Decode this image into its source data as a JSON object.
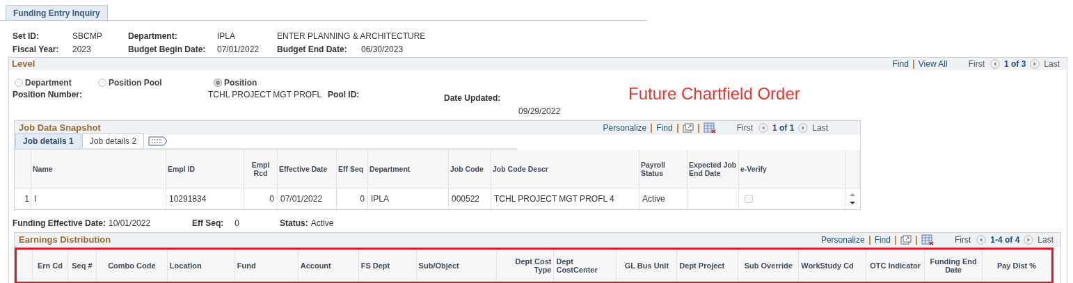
{
  "tabs": [
    {
      "label": "Funding Entry Inquiry",
      "selected": true
    }
  ],
  "header": {
    "rows": [
      {
        "fields": [
          {
            "label": "Set ID:",
            "value": "SBCMP"
          },
          {
            "label": "Department:",
            "value": "IPLA",
            "extra": "ENTER PLANNING & ARCHITECTURE"
          }
        ]
      },
      {
        "fields": [
          {
            "label": "Fiscal Year:",
            "value": "2023"
          },
          {
            "label": "Budget Begin Date:",
            "value": "07/01/2022"
          },
          {
            "label": "Budget End Date:",
            "value": "06/30/2023"
          }
        ]
      }
    ]
  },
  "level": {
    "title": "Level",
    "nav": {
      "find": "Find",
      "view_all": "View All",
      "first": "First",
      "count": "1 of 3",
      "last": "Last"
    },
    "radios": [
      {
        "label": "Department",
        "selected": false
      },
      {
        "label": "Position Pool",
        "selected": false
      },
      {
        "label": "Position",
        "selected": true
      }
    ],
    "position_number_label": "Position Number:",
    "position_descr": "TCHL PROJECT MGT PROFL",
    "pool_id_label": "Pool ID:",
    "date_updated_label": "Date Updated:",
    "date_updated": "09/29/2022",
    "annotation": "Future Chartfield Order"
  },
  "job_snapshot": {
    "title": "Job Data Snapshot",
    "toolbar": {
      "personalize": "Personalize",
      "find": "Find",
      "first": "First",
      "count": "1 of 1",
      "last": "Last"
    },
    "tabs": [
      {
        "label": "Job details 1",
        "selected": true
      },
      {
        "label": "Job details 2",
        "selected": false
      }
    ],
    "columns": [
      "Name",
      "Empl ID",
      "Empl Rcd",
      "Effective Date",
      "Eff Seq",
      "Department",
      "Job Code",
      "Job Code Descr",
      "Payroll Status",
      "Expected Job End Date",
      "e-Verify"
    ],
    "rows": [
      {
        "num": "1",
        "cells": [
          "I",
          "10291834",
          "0",
          "07/01/2022",
          "0",
          "IPLA",
          "000522",
          "TCHL PROJECT MGT PROFL 4",
          "Active",
          ""
        ],
        "everify_checked": false
      }
    ]
  },
  "funding": [
    {
      "label": "Funding Effective Date:",
      "value": "10/01/2022"
    },
    {
      "label": "Eff Seq:",
      "value": "0"
    },
    {
      "label": "Status:",
      "value": "Active"
    }
  ],
  "earnings": {
    "title": "Earnings Distribution",
    "toolbar": {
      "personalize": "Personalize",
      "find": "Find",
      "first": "First",
      "count": "1-4 of 4",
      "last": "Last"
    },
    "columns": [
      "Ern Cd",
      "Seq #",
      "Combo Code",
      "Location",
      "Fund",
      "Account",
      "FS Dept",
      "Sub/Object",
      "Dept Cost Type",
      "Dept CostCenter",
      "GL Bus Unit",
      "Dept Project",
      "Sub Override",
      "WorkStudy Cd",
      "OTC Indicator",
      "Funding End Date",
      "Pay Dist %"
    ]
  }
}
